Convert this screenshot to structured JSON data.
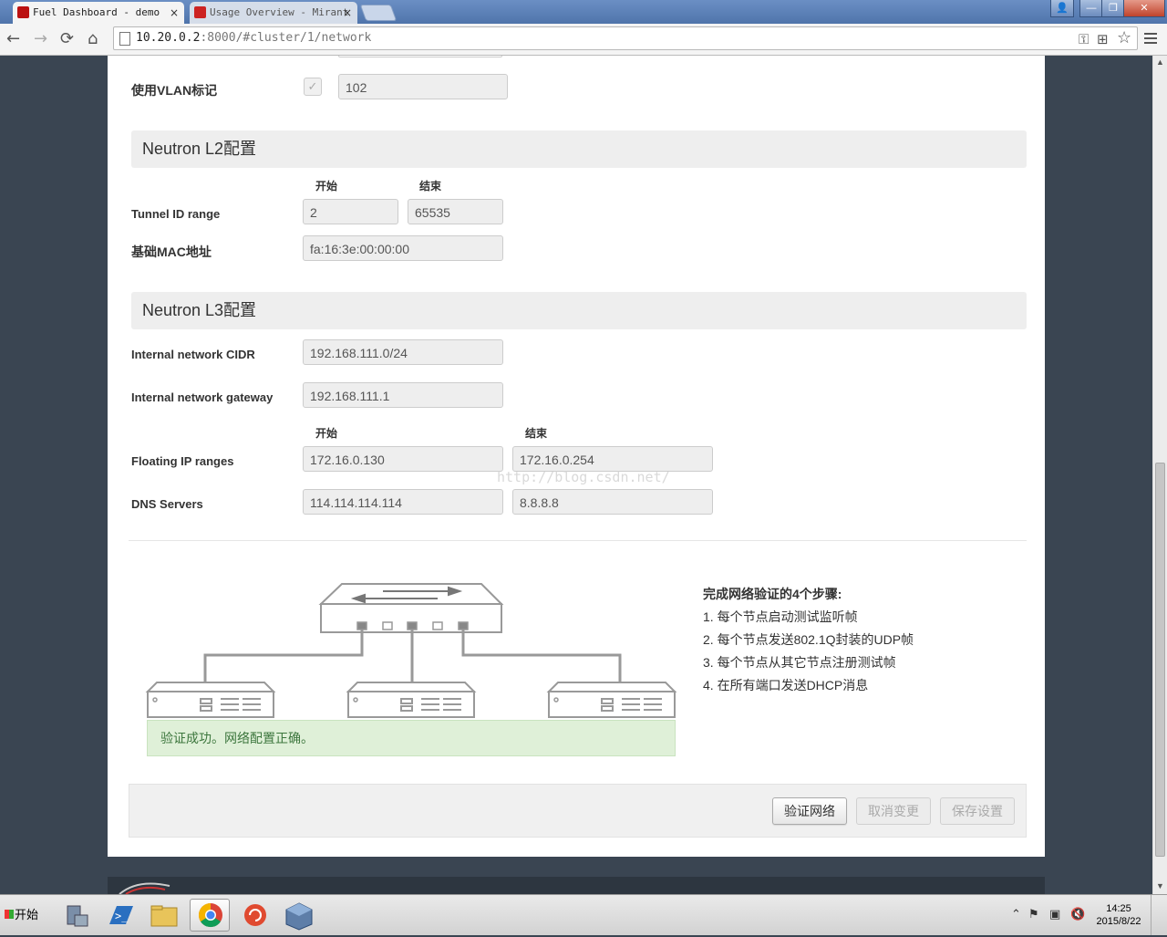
{
  "browser": {
    "tabs": [
      {
        "title": "Fuel Dashboard - demo",
        "close": "×"
      },
      {
        "title": "Usage Overview - Mirant",
        "close": "×"
      }
    ],
    "url_host": "10.20.0.2",
    "url_rest": ":8000/#cluster/1/network",
    "nav": {
      "back": "←",
      "forward": "→",
      "reload": "⟳",
      "home": "⌂"
    },
    "omni_icons": {
      "key": "⚿",
      "translate": "⊞",
      "star": "☆"
    },
    "window": {
      "user": "👤",
      "min": "—",
      "restore": "❐",
      "close": "✕"
    }
  },
  "form": {
    "vlan_label": "使用VLAN标记",
    "vlan_checked": "✓",
    "vlan_value": "102",
    "l2_title": "Neutron L2配置",
    "l2_start": "开始",
    "l2_end": "结束",
    "tunnel_label": "Tunnel ID range",
    "tunnel_start": "2",
    "tunnel_end": "65535",
    "mac_label": "基础MAC地址",
    "mac_value": "fa:16:3e:00:00:00",
    "l3_title": "Neutron L3配置",
    "cidr_label": "Internal network CIDR",
    "cidr_value": "192.168.111.0/24",
    "gateway_label": "Internal network gateway",
    "gateway_value": "192.168.111.1",
    "fip_start_head": "开始",
    "fip_end_head": "结束",
    "fip_label": "Floating IP ranges",
    "fip_start": "172.16.0.130",
    "fip_end": "172.16.0.254",
    "dns_label": "DNS Servers",
    "dns_1": "114.114.114.114",
    "dns_2": "8.8.8.8"
  },
  "watermark": "http://blog.csdn.net/",
  "verification": {
    "success_message": "验证成功。网络配置正确。",
    "steps_title": "完成网络验证的4个步骤:",
    "steps": [
      "1. 每个节点启动测试监听帧",
      "2. 每个节点发送802.1Q封装的UDP帧",
      "3. 每个节点从其它节点注册测试帧",
      "4. 在所有端口发送DHCP消息"
    ]
  },
  "buttons": {
    "verify": "验证网络",
    "cancel": "取消变更",
    "save": "保存设置"
  },
  "taskbar": {
    "start": "开始",
    "tray_arrow": "⌃",
    "time": "14:25",
    "date": "2015/8/22"
  },
  "colors": {
    "success_bg": "#dff0d8",
    "success_text": "#3c763d",
    "section_bg": "#eeeeee",
    "page_bg": "#3a4552"
  }
}
